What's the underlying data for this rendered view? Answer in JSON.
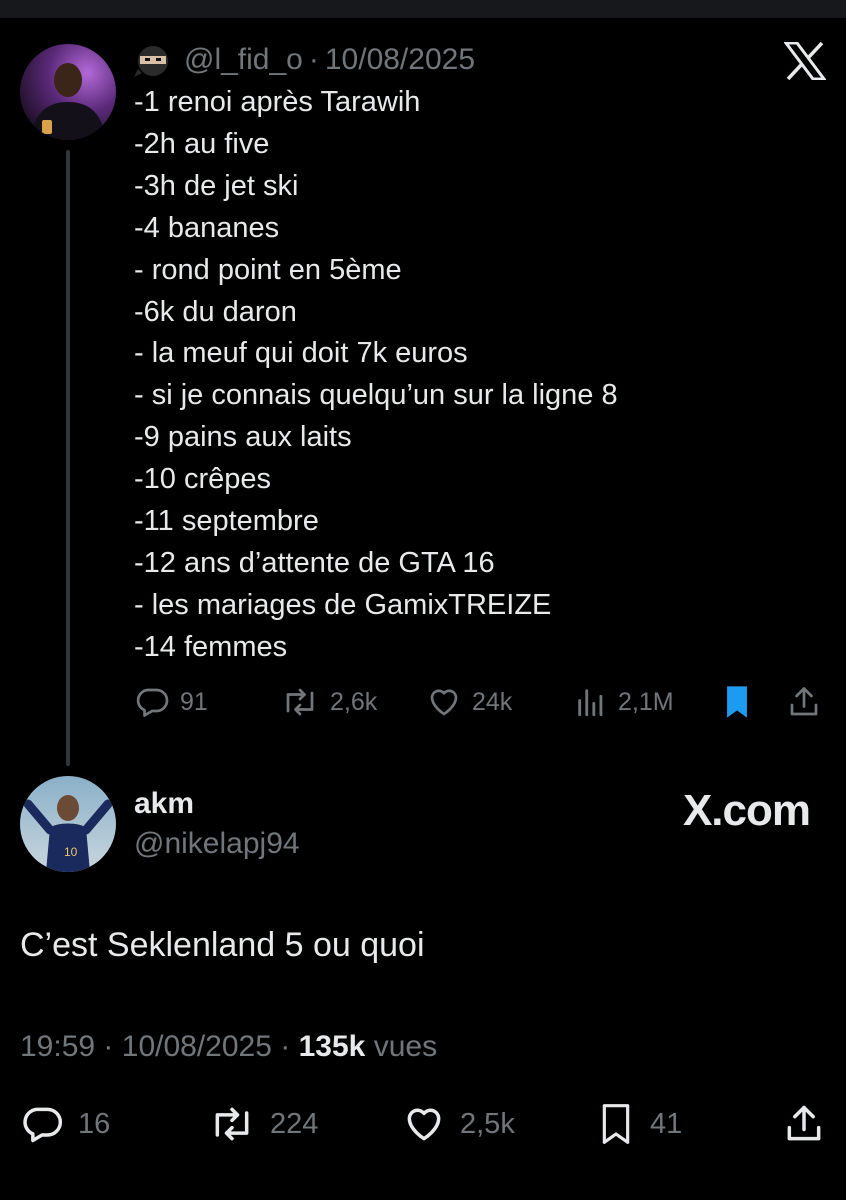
{
  "quoted_tweet": {
    "handle": "@l_fid_o",
    "separator": "·",
    "date": "10/08/2025",
    "lines": [
      "-1 renoi après Tarawih",
      "-2h au five",
      "-3h de jet ski",
      "-4 bananes",
      "- rond point en 5ème",
      "-6k du daron",
      "- la meuf qui doit 7k euros",
      "- si je connais quelqu’un sur la ligne 8",
      "-9 pains aux laits",
      "-10 crêpes",
      "-11 septembre",
      "-12 ans d’attente de GTA 16",
      "- les mariages de GamixTREIZE",
      "-14 femmes"
    ],
    "actions": {
      "replies": "91",
      "reposts": "2,6k",
      "likes": "24k",
      "views": "2,1M"
    },
    "colors": {
      "bookmark_active": "#1d9bf0"
    }
  },
  "reply_tweet": {
    "name": "akm",
    "handle": "@nikelapj94",
    "brand": "X.com",
    "text": "C’est Seklenland 5 ou quoi",
    "time": "19:59",
    "separator": "·",
    "date": "10/08/2025",
    "views_count": "135k",
    "views_label": "vues",
    "actions": {
      "replies": "16",
      "reposts": "224",
      "likes": "2,5k",
      "bookmarks": "41"
    }
  },
  "icons": [
    "ninja-emoji-icon",
    "x-logo-icon",
    "reply-icon",
    "repost-icon",
    "like-icon",
    "views-icon",
    "bookmark-icon",
    "share-icon"
  ]
}
